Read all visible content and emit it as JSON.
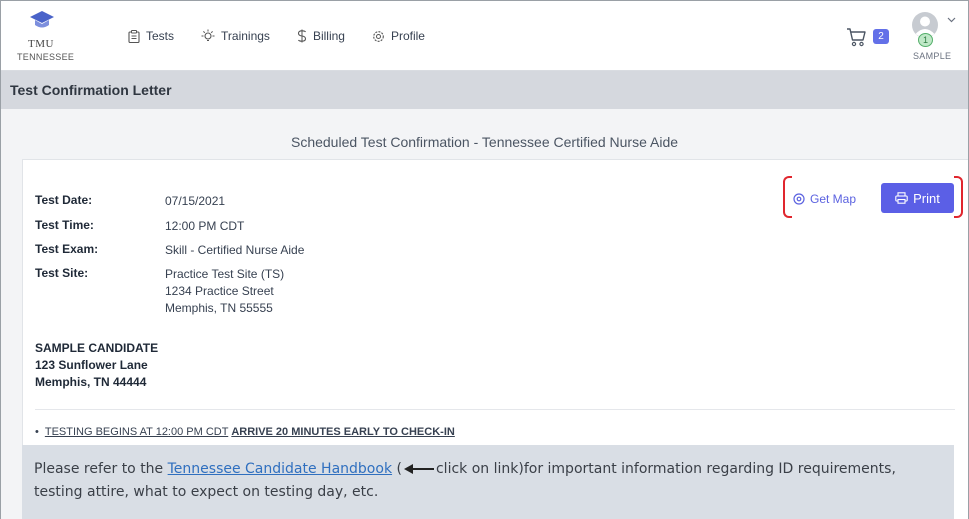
{
  "brand": {
    "line1": "TMU",
    "line2": "TENNESSEE"
  },
  "nav": [
    {
      "label": "Tests",
      "icon": "clipboard-icon"
    },
    {
      "label": "Trainings",
      "icon": "lightbulb-icon"
    },
    {
      "label": "Billing",
      "icon": "dollar-icon"
    },
    {
      "label": "Profile",
      "icon": "gear-icon"
    }
  ],
  "cart": {
    "count": "2"
  },
  "user": {
    "badge": "1",
    "label": "SAMPLE"
  },
  "page": {
    "title": "Test Confirmation Letter"
  },
  "confirmation": {
    "heading": "Scheduled Test Confirmation - Tennessee Certified Nurse Aide",
    "test_date_label": "Test Date:",
    "test_date": "07/15/2021",
    "test_time_label": "Test Time:",
    "test_time": "12:00 PM CDT",
    "test_exam_label": "Test Exam:",
    "test_exam": "Skill - Certified Nurse Aide",
    "test_site_label": "Test Site:",
    "site_name": "Practice Test Site (TS)",
    "site_street": "1234 Practice Street",
    "site_city": "Memphis, TN 55555",
    "get_map_label": "Get Map",
    "print_label": "Print"
  },
  "candidate": {
    "name": "SAMPLE CANDIDATE",
    "street": "123 Sunflower Lane",
    "city": "Memphis, TN 44444"
  },
  "bullet": {
    "part1": "TESTING BEGINS AT 12:00 PM CDT",
    "part2": "ARRIVE 20 MINUTES EARLY TO CHECK-IN"
  },
  "note": {
    "prefix": "Please refer to the ",
    "link": "Tennessee Candidate Handbook",
    "open_paren": " (",
    "callout": "click on link)for important information regarding ID requirements, testing attire, what to expect on testing day, etc."
  },
  "colors": {
    "accent": "#5b5fe6",
    "highlight_bracket": "#e0262e",
    "header_bar": "#d5d8de",
    "note_bg": "#d9dee5"
  }
}
